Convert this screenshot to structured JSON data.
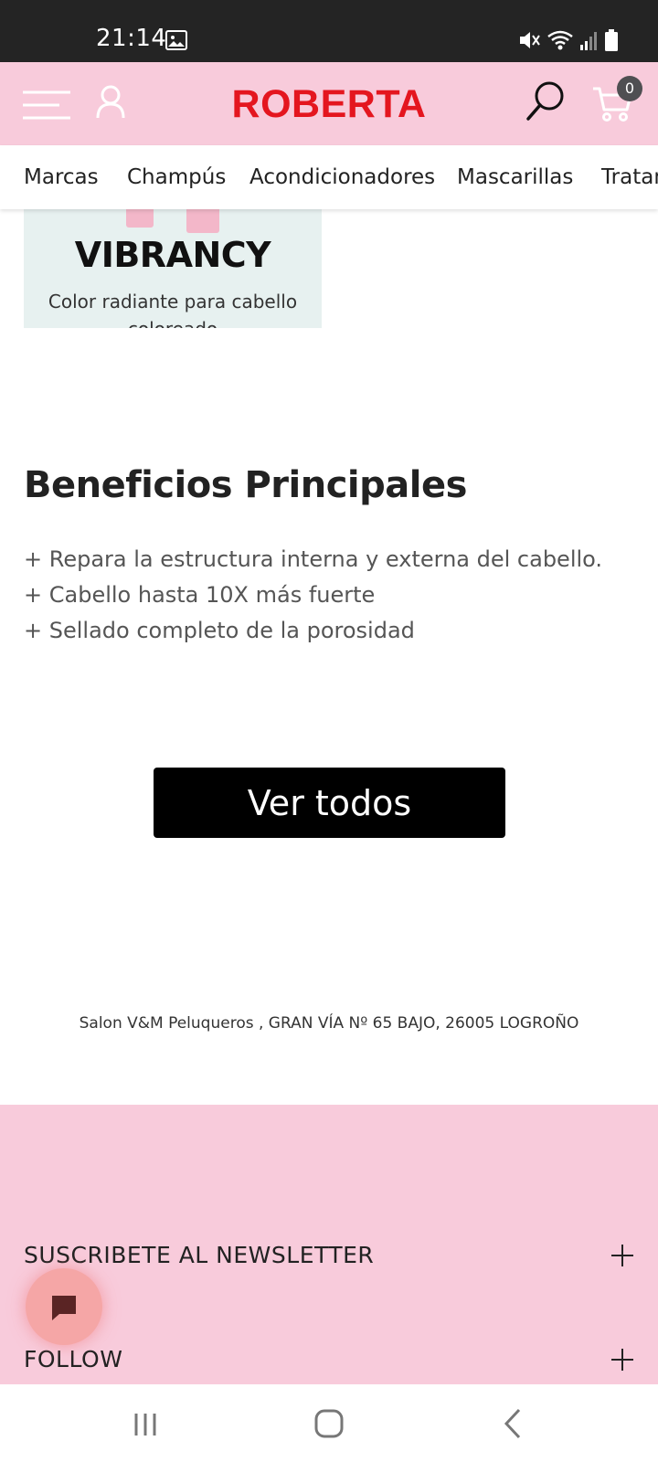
{
  "status_bar": {
    "time": "21:14"
  },
  "header": {
    "logo": "ROBERTA",
    "cart_count": "0",
    "colors": {
      "header_bg": "#f8cbdb",
      "logo": "#e4161f"
    }
  },
  "categories": [
    "Marcas",
    "Champús",
    "Acondicionadores",
    "Mascarillas",
    "Tratamientos"
  ],
  "product": {
    "title": "VIBRANCY",
    "description": "Color radiante para cabello coloreado"
  },
  "benefits": {
    "heading": "Beneficios Principales",
    "items": [
      "+ Repara la estructura interna y externa del cabello.",
      "+ Cabello hasta 10X más fuerte",
      "+ Sellado completo de la porosidad"
    ]
  },
  "view_all_label": "Ver todos",
  "address": "Salon V&M Peluqueros , GRAN VÍA Nº 65 BAJO, 26005 LOGROÑO",
  "footer": {
    "newsletter_label": "SUSCRIBETE AL NEWSLETTER",
    "follow_label": "FOLLOW"
  },
  "icons": {
    "menu": "menu-icon",
    "user": "user-icon",
    "search": "search-icon",
    "cart": "cart-icon",
    "chat": "chat-icon",
    "expand": "plus-icon"
  }
}
